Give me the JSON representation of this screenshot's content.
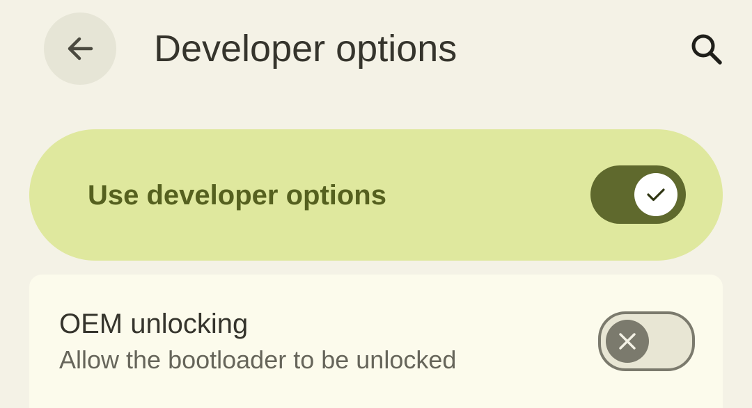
{
  "header": {
    "title": "Developer options",
    "back_icon": "arrow-back-icon",
    "search_icon": "search-icon"
  },
  "main_switch": {
    "label": "Use developer options",
    "checked": true,
    "thumb_icon": "check-icon"
  },
  "oem_unlocking": {
    "title": "OEM unlocking",
    "summary": "Allow the bootloader to be unlocked",
    "checked": false,
    "thumb_icon": "close-icon"
  },
  "colors": {
    "background": "#f4f2e6",
    "main_switch_bg": "#dfe89e",
    "main_switch_text": "#55601f",
    "toggle_on_track": "#5f692d",
    "toggle_off_thumb": "#7b7a6d",
    "card_bg": "#fcfbec",
    "title_text": "#35342c",
    "summary_text": "#66655a"
  }
}
